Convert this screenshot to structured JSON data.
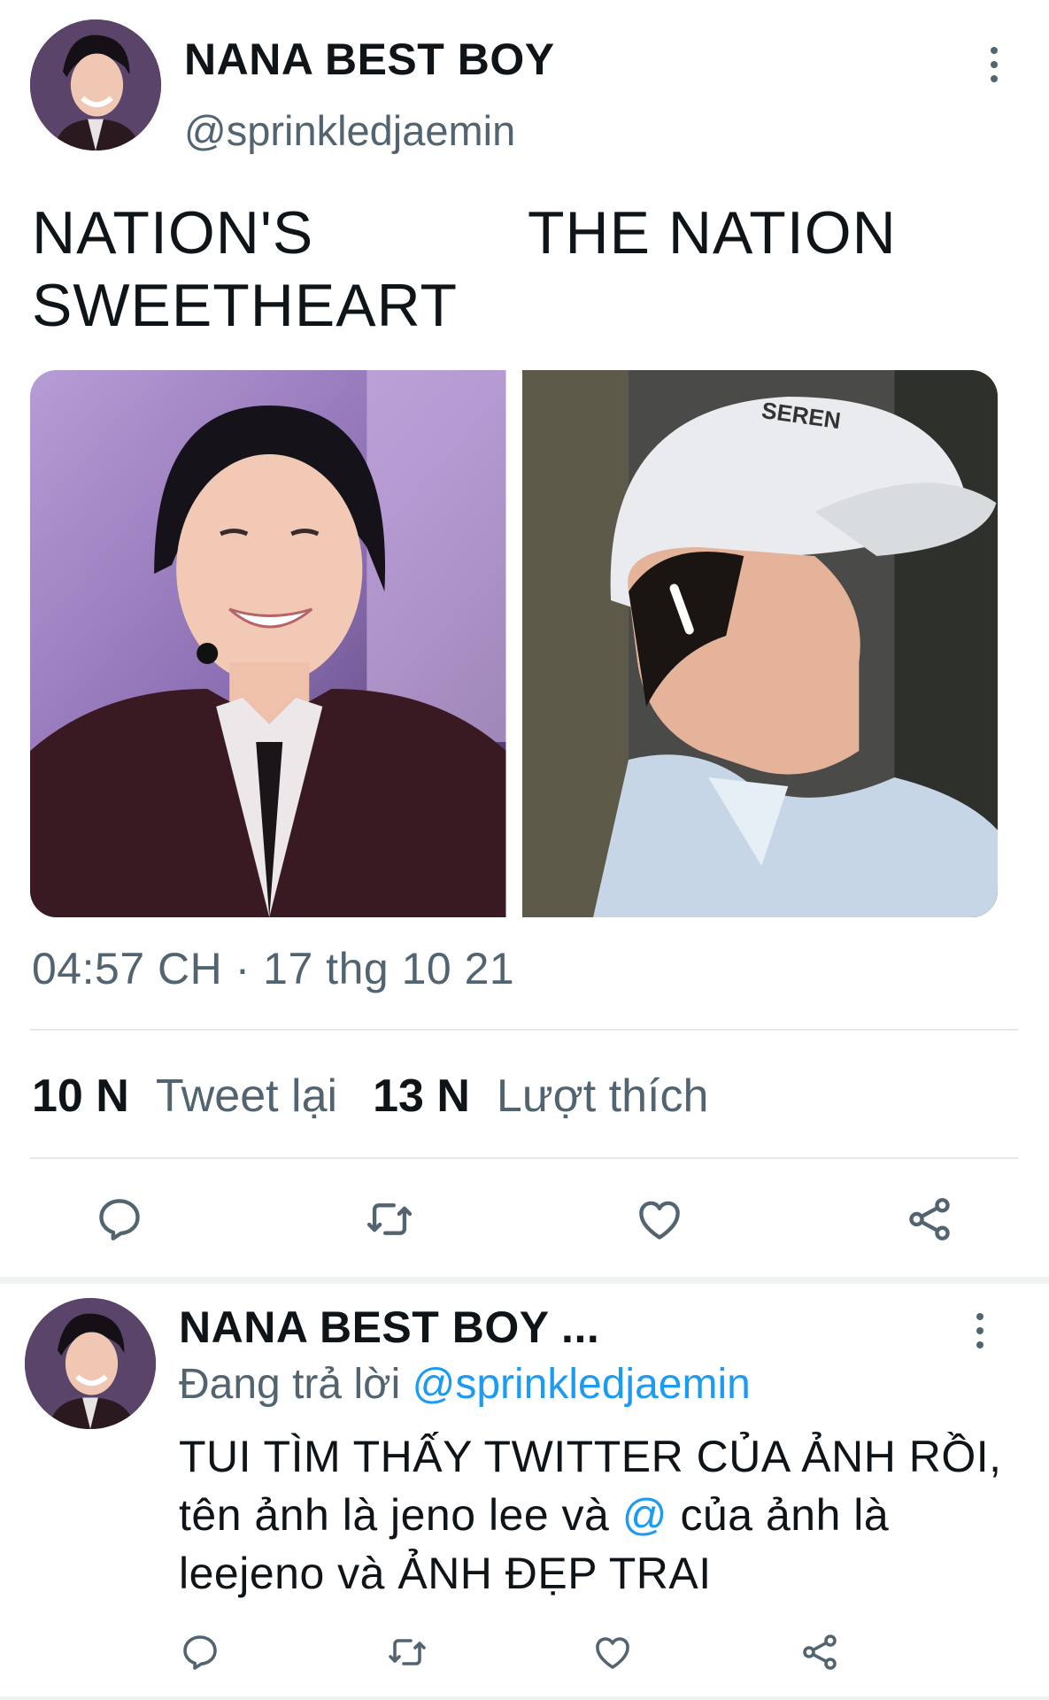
{
  "main_tweet": {
    "display_name": "NANA BEST BOY",
    "handle": "@sprinkledjaemin",
    "text_left": "NATION'S SWEETHEART",
    "text_right": "THE NATION",
    "timestamp": "04:57 CH · 17 thg 10 21",
    "stats": {
      "retweets_count": "10 N",
      "retweets_label": "Tweet lại",
      "likes_count": "13 N",
      "likes_label": "Lượt thích"
    },
    "cap_text": "SEREN"
  },
  "reply_tweet": {
    "display_name": "NANA BEST BOY ...",
    "replying_prefix": "Đang trả lời",
    "replying_to": "@sprinkledjaemin",
    "text_part1": "TUI TÌM THẤY TWITTER CỦA ẢNH RỒI, tên ảnh là jeno lee và",
    "text_mention": "@",
    "text_part2": "của ảnh là leejeno và ẢNH ĐẸP TRAI"
  },
  "icons": {
    "more": "more-vertical-icon",
    "reply": "reply-icon",
    "retweet": "retweet-icon",
    "like": "heart-icon",
    "share": "share-icon"
  },
  "colors": {
    "text": "#0f1419",
    "secondary": "#536471",
    "link": "#1d9bf0",
    "divider": "#e6e9ec"
  }
}
